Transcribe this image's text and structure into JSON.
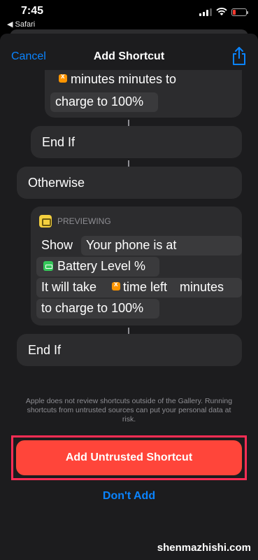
{
  "status": {
    "time": "7:45",
    "back_app": "◀ Safari"
  },
  "nav": {
    "cancel_label": "Cancel",
    "title": "Add Shortcut"
  },
  "blocks": {
    "top_line1_text": "minutes  minutes to",
    "top_line2_text": "charge to 100%",
    "end_if_1": "End If",
    "otherwise": "Otherwise",
    "previewing_label": "PREVIEWING",
    "show_label": "Show",
    "show_text": "Your phone is at",
    "battery_var": "Battery Level %",
    "it_will_take": "It will take",
    "time_left_var": "time left",
    "minutes_text": "minutes",
    "charge_text": "to charge to 100%",
    "end_if_2": "End If"
  },
  "disclaimer": "Apple does not review shortcuts outside of the Gallery. Running shortcuts from untrusted sources can put your personal data at risk.",
  "actions": {
    "add_label": "Add Untrusted Shortcut",
    "dont_add_label": "Don't Add"
  },
  "watermark": "shenmazhishi.com",
  "colors": {
    "accent_blue": "#0a84ff",
    "add_button_red": "#ff453a",
    "highlight_frame": "#ff2d55"
  }
}
